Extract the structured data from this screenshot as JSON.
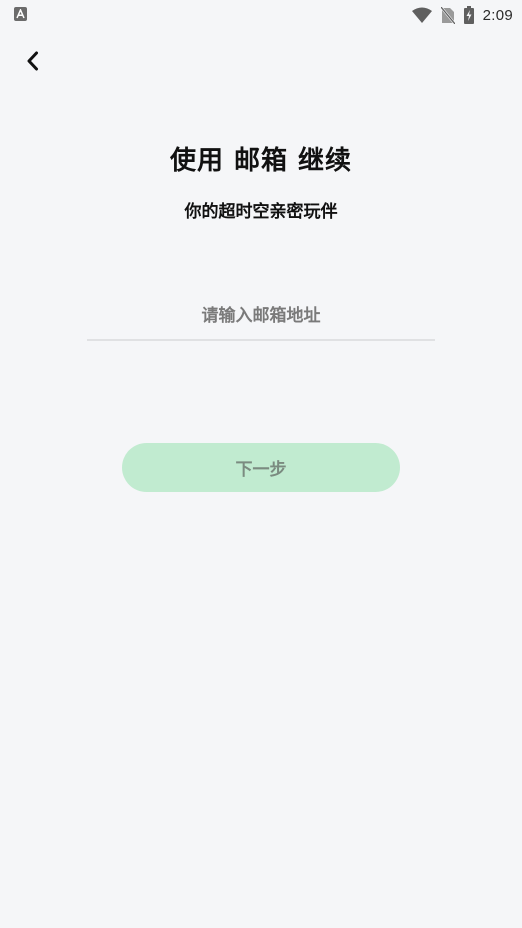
{
  "status_bar": {
    "time": "2:09",
    "icons": [
      "accessibility-icon",
      "wifi-icon",
      "no-sim-icon",
      "battery-charging-icon"
    ]
  },
  "header": {
    "back_icon": "chevron-left-icon"
  },
  "main": {
    "title": "使用 邮箱 继续",
    "subtitle": "你的超时空亲密玩伴",
    "email_input": {
      "placeholder": "请输入邮箱地址",
      "value": ""
    },
    "next_button_label": "下一步"
  },
  "colors": {
    "background": "#f5f6f8",
    "button_background": "#c1ebd0",
    "button_text": "#7b8b80",
    "input_underline": "#e0e1e3"
  }
}
